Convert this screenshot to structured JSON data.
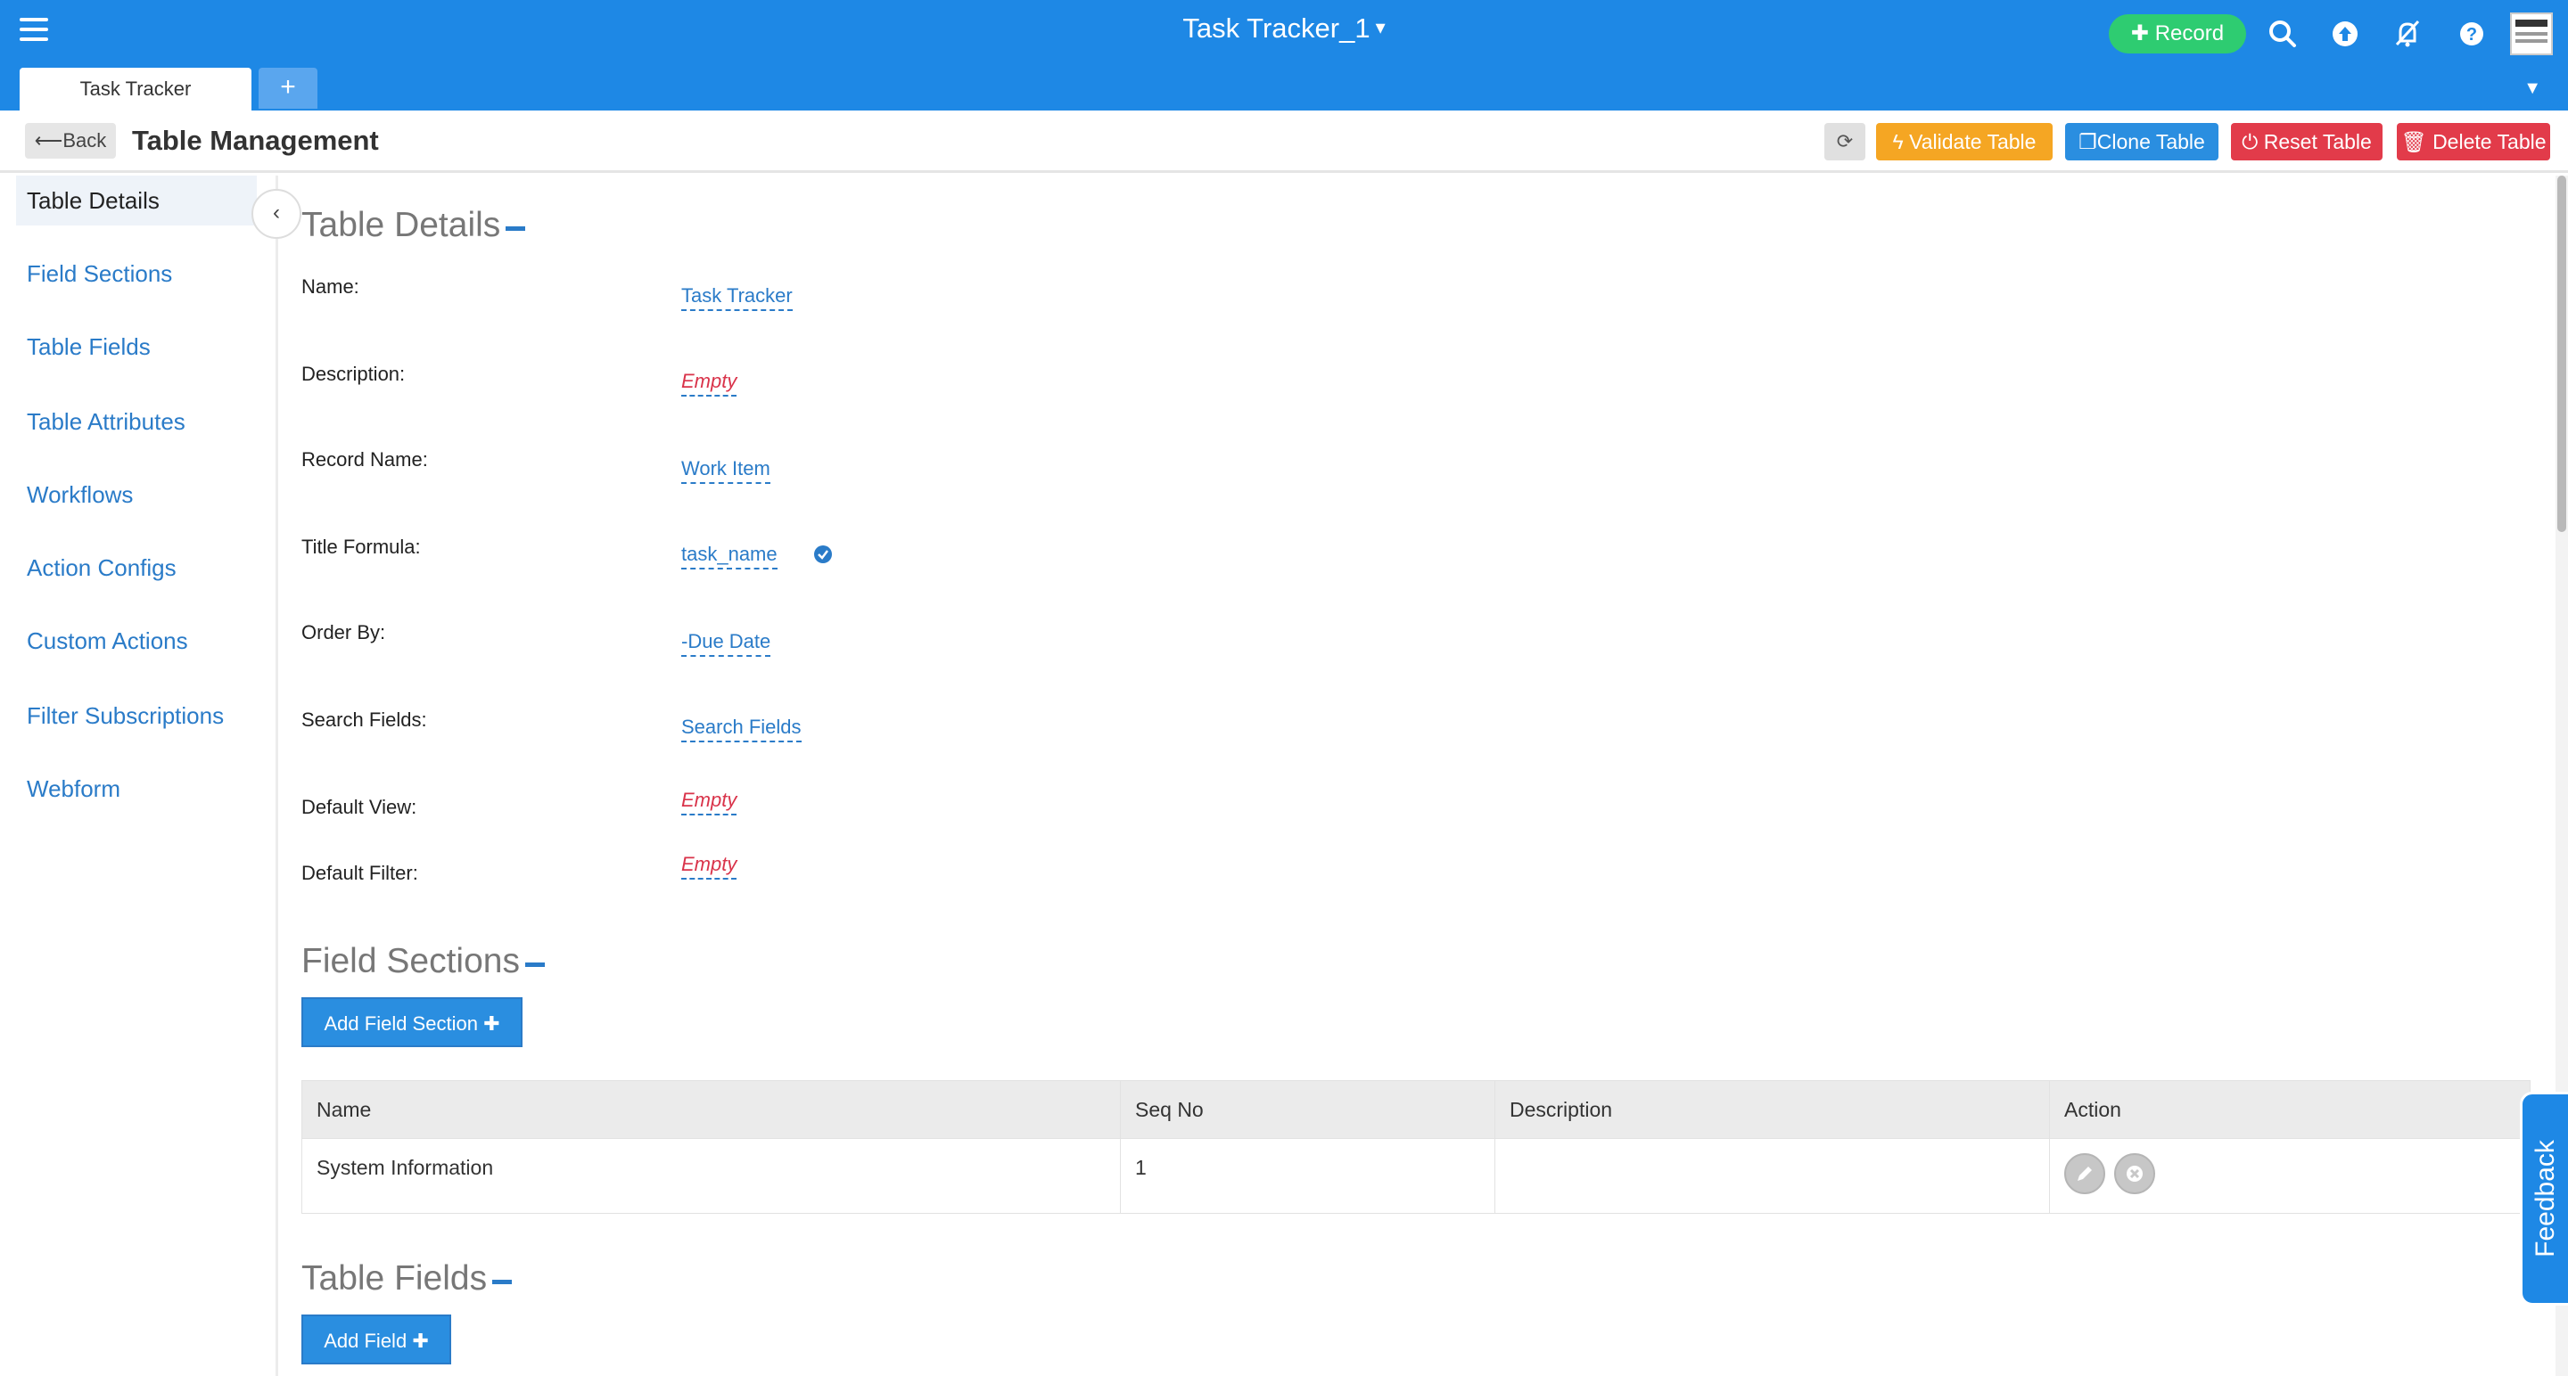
{
  "app": {
    "title": "Task Tracker_1",
    "record_label": "Record",
    "tabs": [
      {
        "label": "Task Tracker",
        "active": true
      }
    ],
    "add_tab_label": "+"
  },
  "header": {
    "back_label": "Back",
    "page_title": "Table Management",
    "actions": {
      "validate": "Validate Table",
      "clone": "Clone Table",
      "reset": "Reset Table",
      "delete": "Delete Table"
    }
  },
  "sidebar": {
    "items": [
      {
        "label": "Table Details",
        "active": true
      },
      {
        "label": "Field Sections"
      },
      {
        "label": "Table Fields"
      },
      {
        "label": "Table Attributes"
      },
      {
        "label": "Workflows"
      },
      {
        "label": "Action Configs"
      },
      {
        "label": "Custom Actions"
      },
      {
        "label": "Filter Subscriptions"
      },
      {
        "label": "Webform"
      }
    ]
  },
  "table_details": {
    "title": "Table Details",
    "fields": [
      {
        "label": "Name:",
        "value": "Task Tracker"
      },
      {
        "label": "Description:",
        "value": "Empty",
        "empty": true
      },
      {
        "label": "Record Name:",
        "value": "Work Item"
      },
      {
        "label": "Title Formula:",
        "value": "task_name",
        "verified": true
      },
      {
        "label": "Order By:",
        "value": "-Due Date"
      },
      {
        "label": "Search Fields:",
        "value": "Search Fields"
      },
      {
        "label": "Default View:",
        "value": "Empty",
        "empty": true
      },
      {
        "label": "Default Filter:",
        "value": "Empty",
        "empty": true
      }
    ]
  },
  "field_sections": {
    "title": "Field Sections",
    "add_button": "Add Field Section",
    "columns": [
      "Name",
      "Seq No",
      "Description",
      "Action"
    ],
    "rows": [
      {
        "name": "System Information",
        "seq": "1",
        "description": ""
      }
    ]
  },
  "table_fields": {
    "title": "Table Fields",
    "add_button": "Add Field"
  },
  "feedback_label": "Feedback",
  "colors": {
    "topbar": "#1e88e5",
    "record_green": "#2ecc71",
    "validate_orange": "#f5a623",
    "clone_blue": "#2a8ee0",
    "danger_red": "#e23b4a",
    "link_blue": "#2a7bc8",
    "empty_red": "#d9334a"
  }
}
